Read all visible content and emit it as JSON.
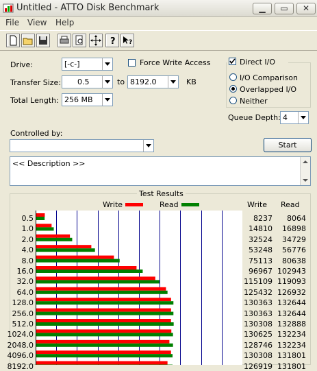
{
  "window": {
    "title": "Untitled - ATTO Disk Benchmark",
    "minimize": "▁",
    "maximize": "▭",
    "close": "✕"
  },
  "menu": [
    "File",
    "View",
    "Help"
  ],
  "toolbar": {
    "icons": [
      "new-icon",
      "open-icon",
      "save-icon",
      "print-icon",
      "print-preview-icon",
      "move-icon",
      "help-icon",
      "context-help-icon"
    ]
  },
  "form": {
    "drive_label": "Drive:",
    "drive_value": "[-c-]",
    "force_write_label": "Force Write Access",
    "force_write_checked": false,
    "transfer_label": "Transfer Size:",
    "transfer_from": "0.5",
    "to_label": "to",
    "transfer_to": "8192.0",
    "kb_label": "KB",
    "total_length_label": "Total Length:",
    "total_length_value": "256 MB",
    "direct_io_label": "Direct I/O",
    "direct_io_checked": true,
    "io_comparison_label": "I/O Comparison",
    "overlapped_io_label": "Overlapped I/O",
    "neither_label": "Neither",
    "selected_mode": "Overlapped I/O",
    "queue_depth_label": "Queue Depth:",
    "queue_depth_value": "4",
    "controlled_by_label": "Controlled by:",
    "controlled_by_value": "",
    "start_label": "Start",
    "description": "<< Description >>"
  },
  "results": {
    "title": "Test Results",
    "write_legend": "Write",
    "read_legend": "Read",
    "write_header": "Write",
    "read_header": "Read",
    "write_color": "#ff0000",
    "read_color": "#008000",
    "grid_color": "#00008b"
  },
  "chart_data": {
    "type": "bar",
    "orientation": "horizontal",
    "categories": [
      "0.5",
      "1.0",
      "2.0",
      "4.0",
      "8.0",
      "16.0",
      "32.0",
      "64.0",
      "128.0",
      "256.0",
      "512.0",
      "1024.0",
      "2048.0",
      "4096.0",
      "8192.0"
    ],
    "series": [
      {
        "name": "Write",
        "values": [
          8237,
          14810,
          32524,
          53248,
          75113,
          96967,
          115109,
          125432,
          130363,
          130363,
          130308,
          130625,
          128746,
          130308,
          126919
        ]
      },
      {
        "name": "Read",
        "values": [
          8064,
          16898,
          34729,
          56776,
          80638,
          102943,
          119093,
          126932,
          132644,
          132644,
          132888,
          132234,
          132234,
          131801,
          131801
        ]
      }
    ],
    "xlim": [
      0,
      200000
    ],
    "grid": true
  }
}
